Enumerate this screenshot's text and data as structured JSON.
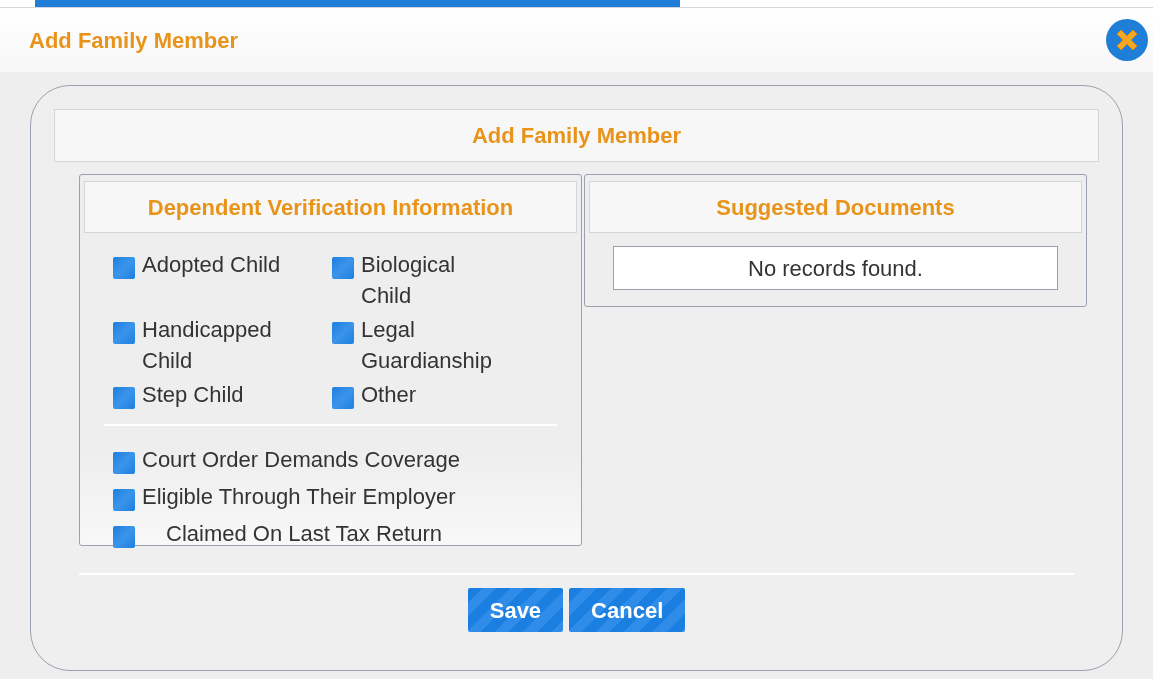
{
  "dialog": {
    "title": "Add Family Member"
  },
  "form_title": "Add Family Member",
  "verification": {
    "title": "Dependent Verification Information",
    "relationships": [
      {
        "label": "Adopted Child",
        "checked": false
      },
      {
        "label": "Biological Child",
        "checked": false
      },
      {
        "label": "Handicapped Child",
        "checked": false
      },
      {
        "label": "Legal Guardianship",
        "checked": false
      },
      {
        "label": "Step Child",
        "checked": false
      },
      {
        "label": "Other",
        "checked": false
      }
    ],
    "conditions": [
      {
        "label": "Court Order Demands Coverage",
        "checked": false
      },
      {
        "label": "Eligible Through Their Employer",
        "checked": false
      },
      {
        "label": "Claimed On Last Tax Return",
        "checked": false
      }
    ]
  },
  "documents": {
    "title": "Suggested Documents",
    "empty_message": "No records found."
  },
  "buttons": [
    "Save",
    "Cancel"
  ]
}
